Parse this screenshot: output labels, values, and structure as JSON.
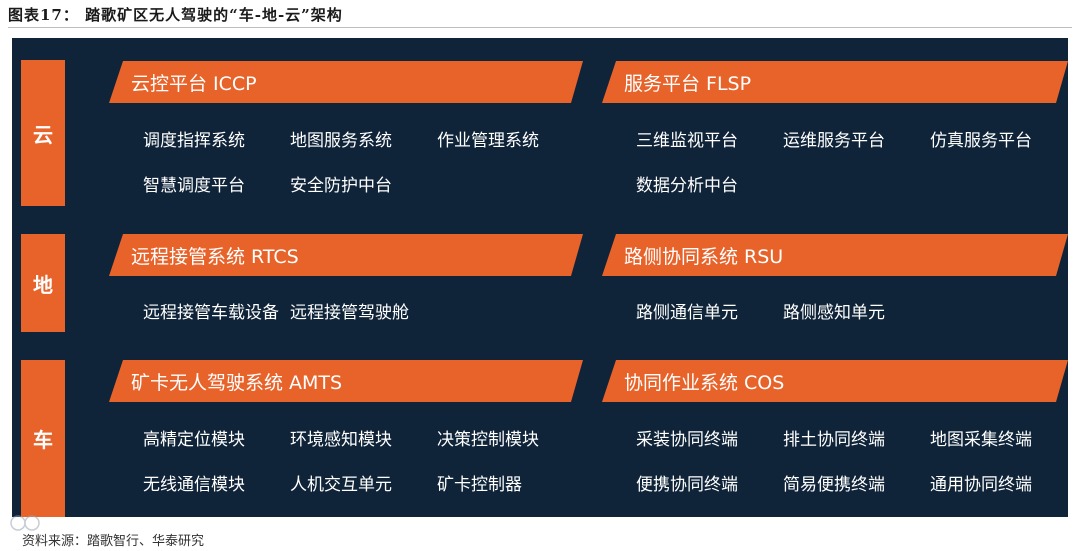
{
  "figure_title": "图表17： 踏歌矿区无人驾驶的“车-地-云”架构",
  "source": "资料来源：踏歌智行、华泰研究",
  "layers": {
    "cloud": {
      "label": "云",
      "left_system": {
        "name": "云控平台 ICCP",
        "items": [
          "调度指挥系统",
          "地图服务系统",
          "作业管理系统",
          "智慧调度平台",
          "安全防护中台"
        ]
      },
      "right_system": {
        "name": "服务平台 FLSP",
        "items": [
          "三维监视平台",
          "运维服务平台",
          "仿真服务平台",
          "数据分析中台"
        ]
      }
    },
    "ground": {
      "label": "地",
      "left_system": {
        "name": "远程接管系统 RTCS",
        "items": [
          "远程接管车载设备",
          "远程接管驾驶舱"
        ]
      },
      "right_system": {
        "name": "路侧协同系统 RSU",
        "items": [
          "路侧通信单元",
          "路侧感知单元"
        ]
      }
    },
    "vehicle": {
      "label": "车",
      "left_system": {
        "name": "矿卡无人驾驶系统 AMTS",
        "items": [
          "高精定位模块",
          "环境感知模块",
          "决策控制模块",
          "无线通信模块",
          "人机交互单元",
          "矿卡控制器"
        ]
      },
      "right_system": {
        "name": "协同作业系统 COS",
        "items": [
          "采装协同终端",
          "排土协同终端",
          "地图采集终端",
          "便携协同终端",
          "简易便携终端",
          "通用协同终端"
        ]
      }
    }
  },
  "colors": {
    "panel_bg": "#0f2339",
    "accent": "#e8632a",
    "text": "#ffffff"
  }
}
